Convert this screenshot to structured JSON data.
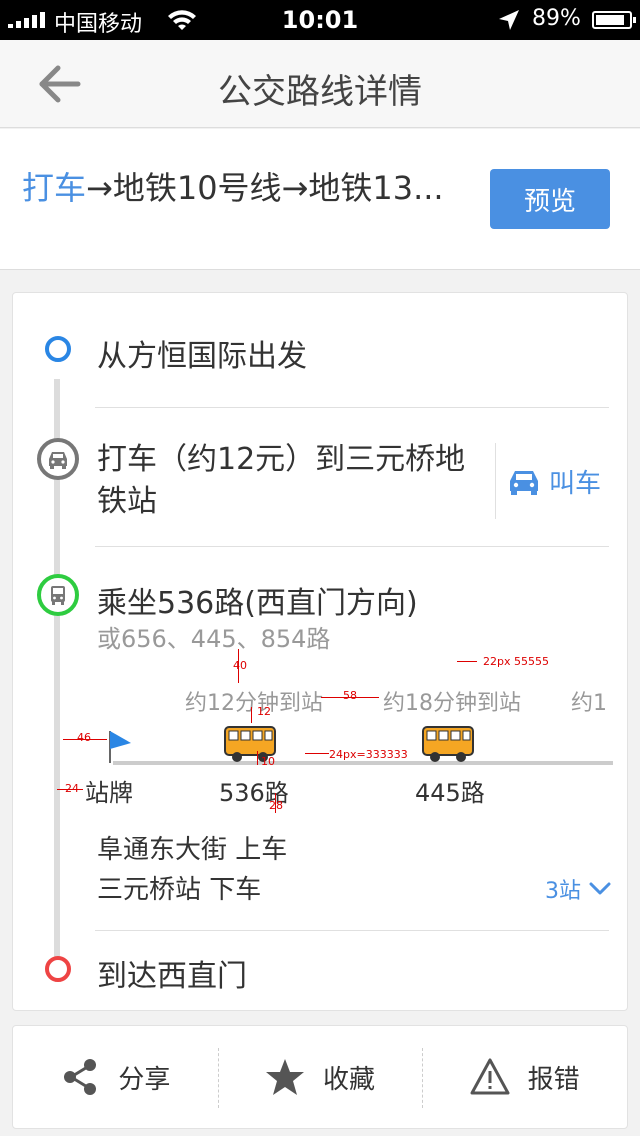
{
  "status_bar": {
    "carrier": "中国移动",
    "time": "10:01",
    "battery": "89%"
  },
  "nav": {
    "title": "公交路线详情"
  },
  "route": {
    "summary_taxi": "打车",
    "summary_rest": "→地铁10号线→地铁13...",
    "preview_label": "预览"
  },
  "steps": {
    "start": "从方恒国际出发",
    "taxi": "打车（约12元）到三元桥地铁站",
    "call_taxi": "叫车",
    "bus_title": "乘坐536路(西直门方向)",
    "bus_alternatives": "或656、445、854路",
    "eta_1": "约12分钟到站",
    "eta_2": "约18分钟到站",
    "eta_3": "约1",
    "stop_sign": "站牌",
    "bus_1": "536路",
    "bus_2": "445路",
    "board": "阜通东大街   上车",
    "alight": "三元桥站   下车",
    "stops_count": "3站",
    "end": "到达西直门"
  },
  "annotations": {
    "a40": "40",
    "a12": "12",
    "a58": "58",
    "a46": "46",
    "a24": "24",
    "a10": "10",
    "a28": "28",
    "font_22": "22px  55555",
    "font_24": "24px=333333"
  },
  "actions": {
    "share": "分享",
    "favorite": "收藏",
    "report": "报错"
  },
  "colors": {
    "accent": "#4a90e2",
    "start": "#2a86e4",
    "end": "#ee4444",
    "bus": "#2ecc40",
    "bus_body": "#f5a623"
  }
}
